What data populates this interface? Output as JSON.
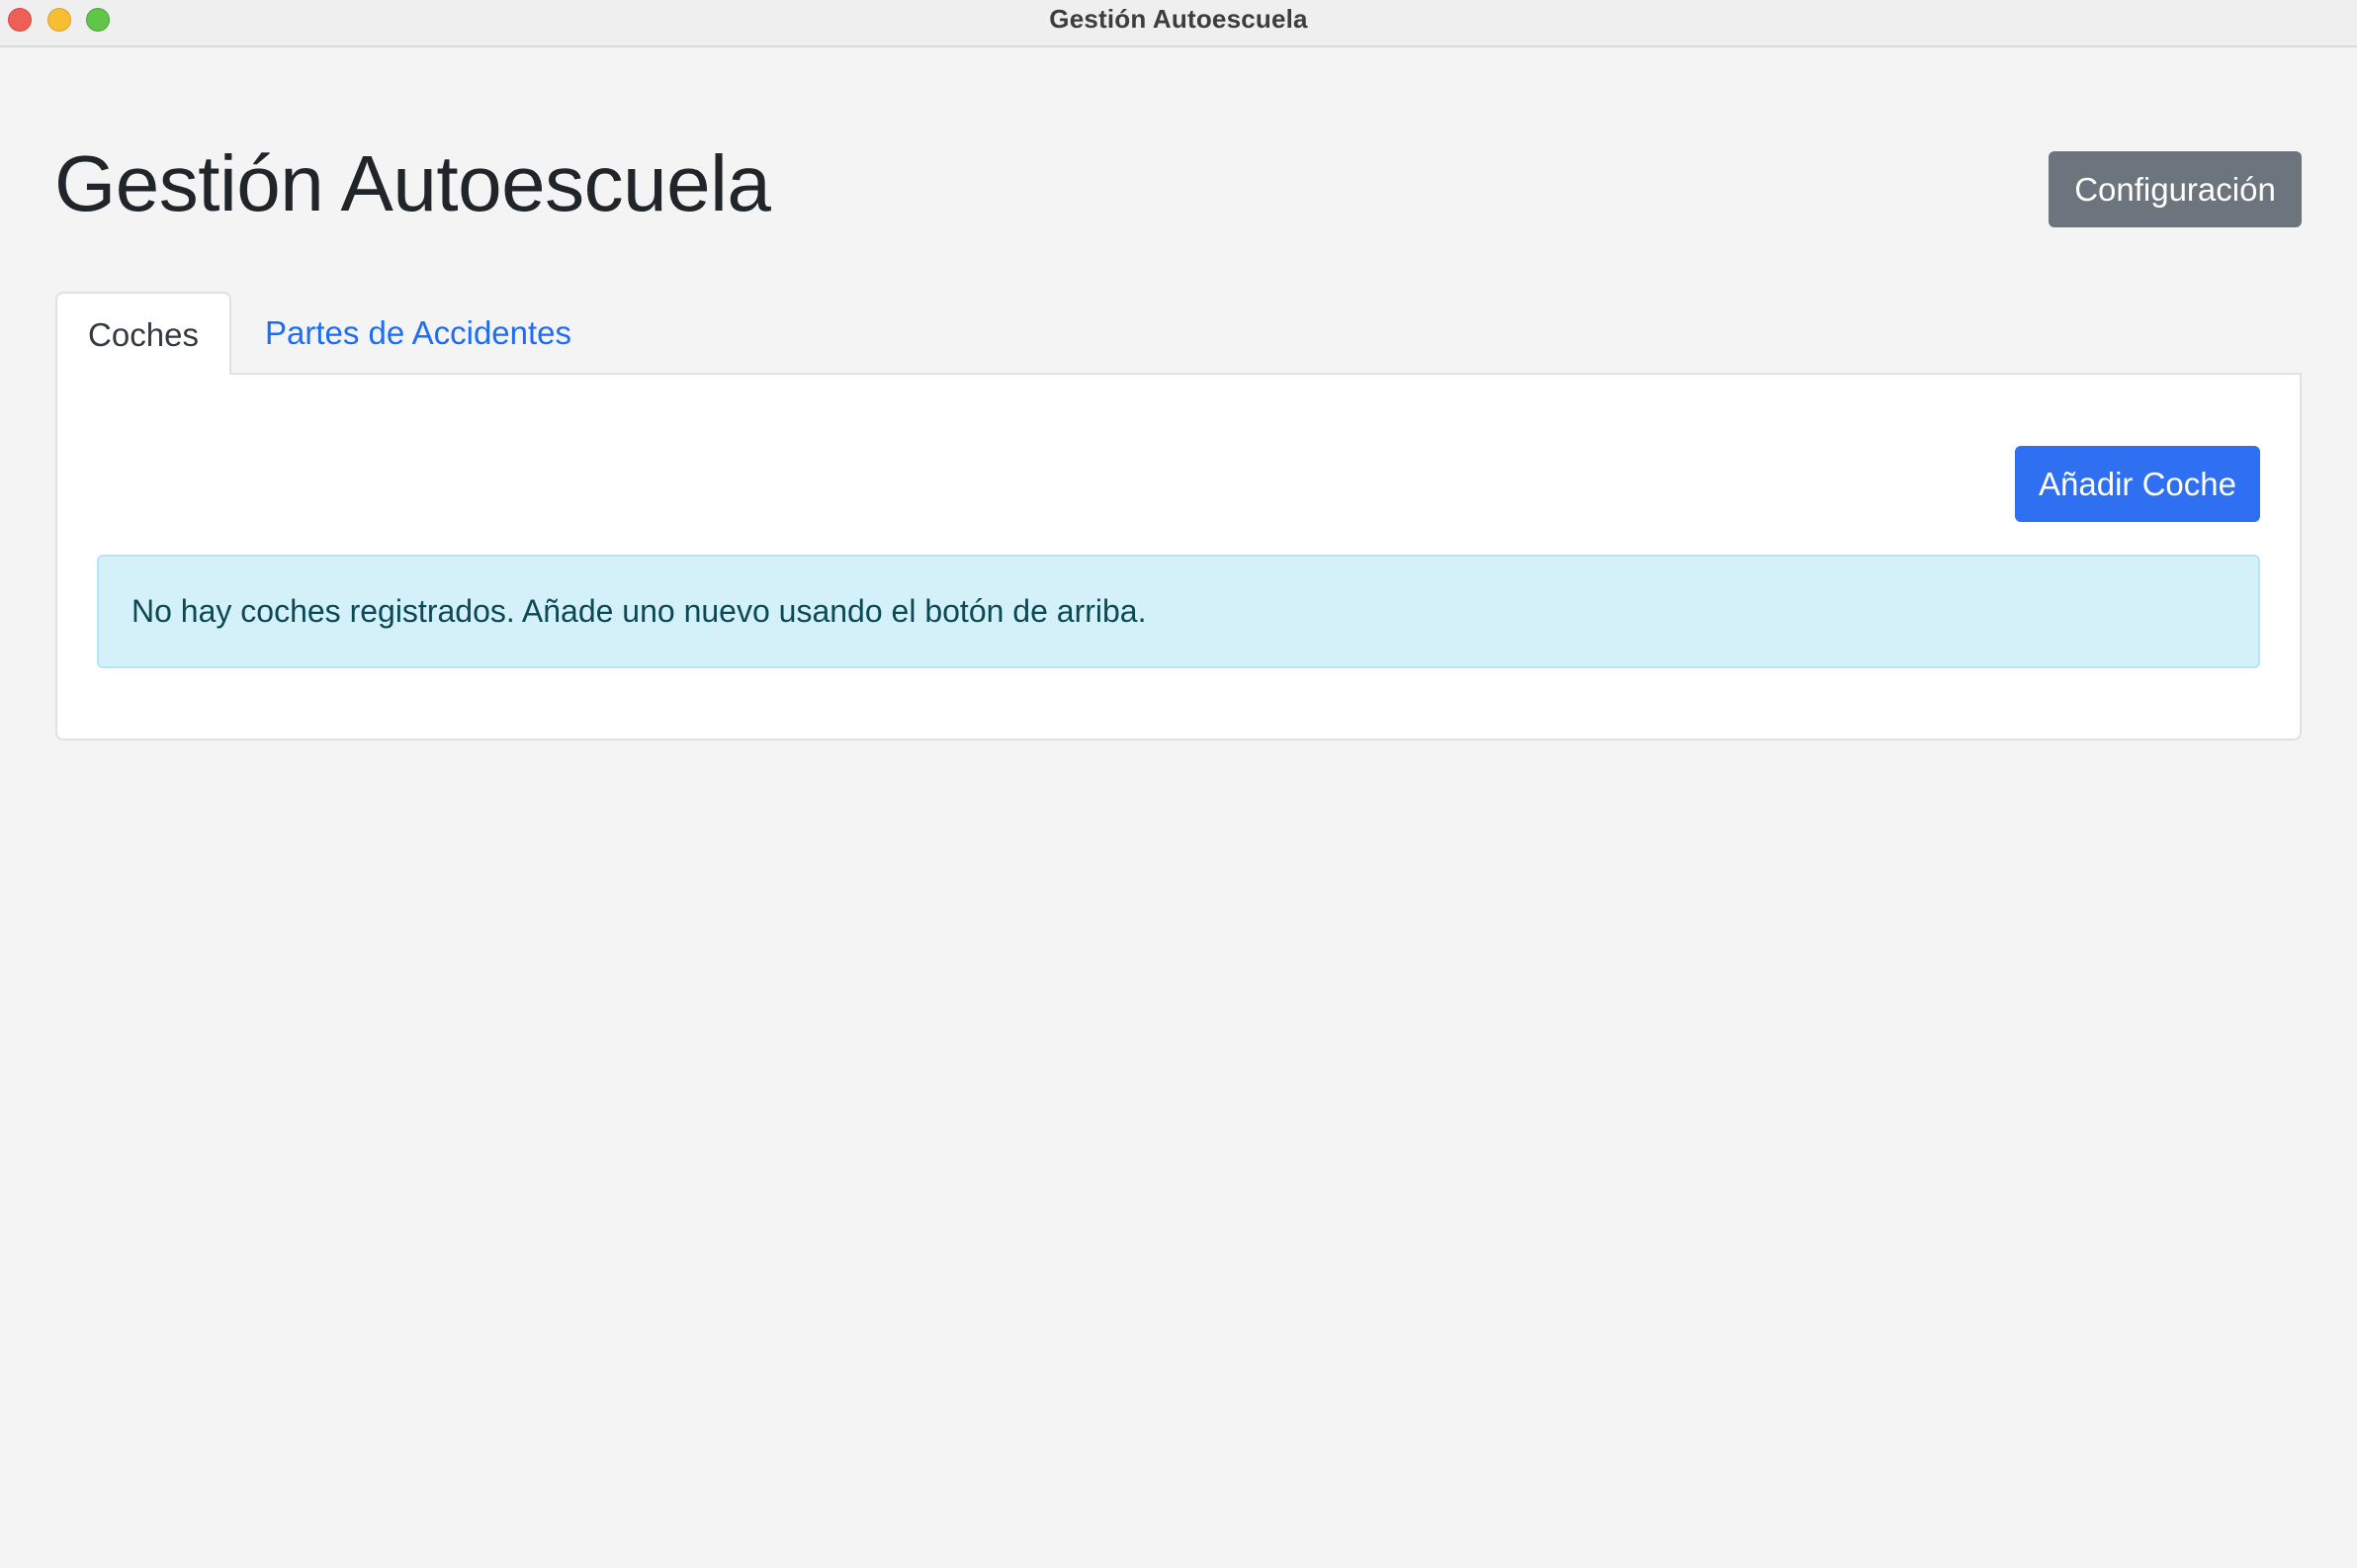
{
  "window": {
    "title": "Gestión Autoescuela"
  },
  "header": {
    "title": "Gestión Autoescuela",
    "config_label": "Configuración"
  },
  "tabs": [
    {
      "label": "Coches",
      "active": true
    },
    {
      "label": "Partes de Accidentes",
      "active": false
    }
  ],
  "panel": {
    "add_label": "Añadir Coche",
    "empty_message": "No hay coches registrados. Añade uno nuevo usando el botón de arriba."
  },
  "colors": {
    "primary": "#2f6ff2",
    "secondary": "#6c757d",
    "info_bg": "#d4f1f9",
    "info_text": "#0c4956",
    "link": "#1f6df2"
  }
}
